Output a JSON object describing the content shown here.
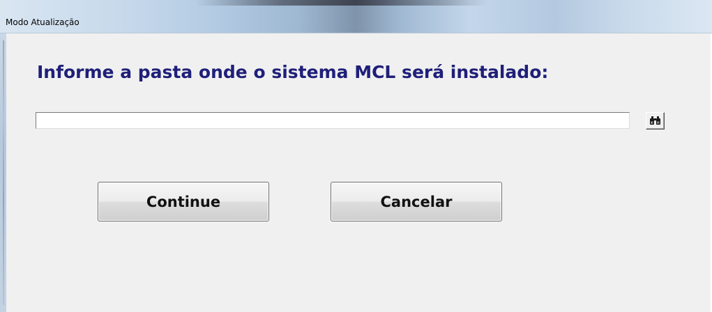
{
  "window": {
    "title": "Modo Atualização"
  },
  "dialog": {
    "prompt": "Informe a pasta onde o sistema MCL será instalado:",
    "path_value": "",
    "path_placeholder": "",
    "browse_icon": "binoculars-icon"
  },
  "buttons": {
    "continue_label": "Continue",
    "cancel_label": "Cancelar"
  },
  "colors": {
    "prompt_text": "#1f1f7a",
    "client_background": "#f0f0f0"
  }
}
